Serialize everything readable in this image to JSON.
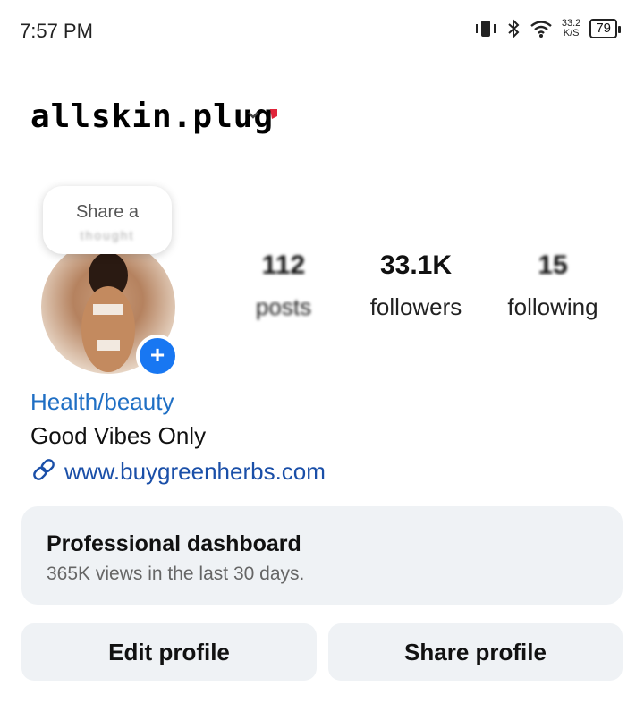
{
  "status_bar": {
    "time": "7:57 PM",
    "net_speed_value": "33.2",
    "net_speed_unit": "K/S",
    "battery": "79",
    "icons": [
      "vibrate-icon",
      "bluetooth-icon",
      "wifi-icon",
      "battery-icon"
    ]
  },
  "profile": {
    "username": "allskin.plug",
    "note": {
      "line1": "Share a",
      "line2": "thought"
    },
    "stats": [
      {
        "value": "112",
        "label": "posts"
      },
      {
        "value": "33.1K",
        "label": "followers"
      },
      {
        "value": "15",
        "label": "following"
      }
    ],
    "category": "Health/beauty",
    "bio": "Good Vibes Only",
    "link": "www.buygreenherbs.com"
  },
  "dashboard": {
    "title": "Professional dashboard",
    "subtitle": "365K views in the last 30 days."
  },
  "actions": {
    "edit_label": "Edit profile",
    "share_label": "Share profile"
  },
  "colors": {
    "accent": "#1877f2",
    "category": "#1f6fc4",
    "link": "#1a4fa8",
    "card_bg": "#eff2f5"
  }
}
